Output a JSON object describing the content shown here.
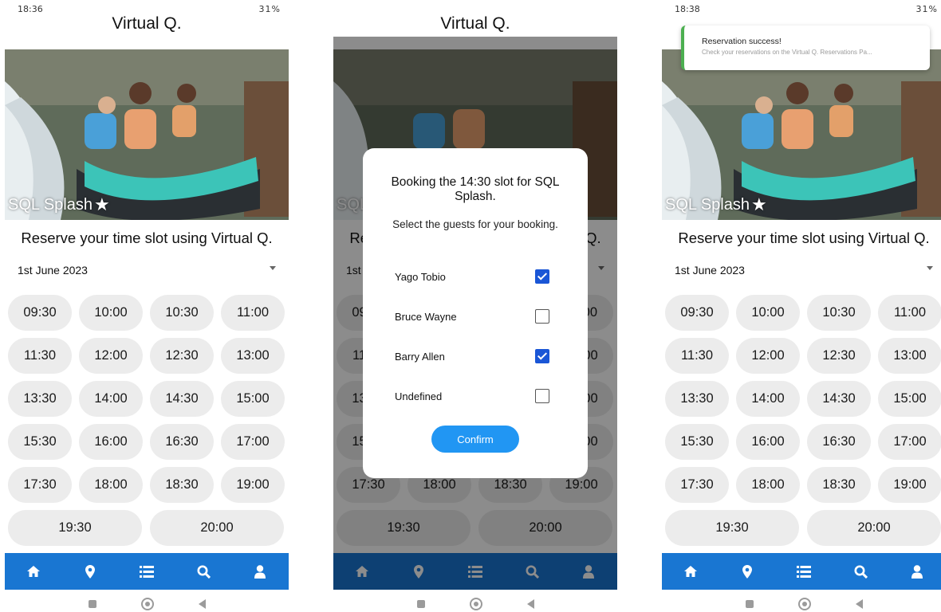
{
  "screens": [
    {
      "status_time": "18:36",
      "status_right": "31%"
    },
    {
      "status_time": "",
      "status_right": ""
    },
    {
      "status_time": "18:38",
      "status_right": "31%"
    }
  ],
  "app_title": "Virtual Q.",
  "hero_label": "SQL Splash",
  "subtitle": "Reserve your time slot using Virtual Q.",
  "date_select": {
    "value": "1st June 2023"
  },
  "slots_row": [
    "09:30",
    "10:00",
    "10:30",
    "11:00",
    "11:30",
    "12:00",
    "12:30",
    "13:00",
    "13:30",
    "14:00",
    "14:30",
    "15:00",
    "15:30",
    "16:00",
    "16:30",
    "17:00",
    "17:30",
    "18:00",
    "18:30",
    "19:00"
  ],
  "slots_last": [
    "19:30",
    "20:00"
  ],
  "nav_icons": [
    "home-icon",
    "location-pin-icon",
    "list-icon",
    "search-icon",
    "user-icon"
  ],
  "dialog": {
    "title": "Booking the 14:30 slot for SQL Splash.",
    "subtitle": "Select the guests for your booking.",
    "guests": [
      {
        "name": "Yago Tobio",
        "checked": true
      },
      {
        "name": "Bruce Wayne",
        "checked": false
      },
      {
        "name": "Barry Allen",
        "checked": true
      },
      {
        "name": "Undefined",
        "checked": false
      }
    ],
    "confirm_label": "Confirm"
  },
  "toast": {
    "title": "Reservation success!",
    "message": "Check your reservations on the Virtual Q. Reservations Pa..."
  },
  "colors": {
    "nav": "#1976d2",
    "confirm": "#2196f3",
    "checkbox": "#1a56d6",
    "toast_accent": "#4caf50"
  }
}
